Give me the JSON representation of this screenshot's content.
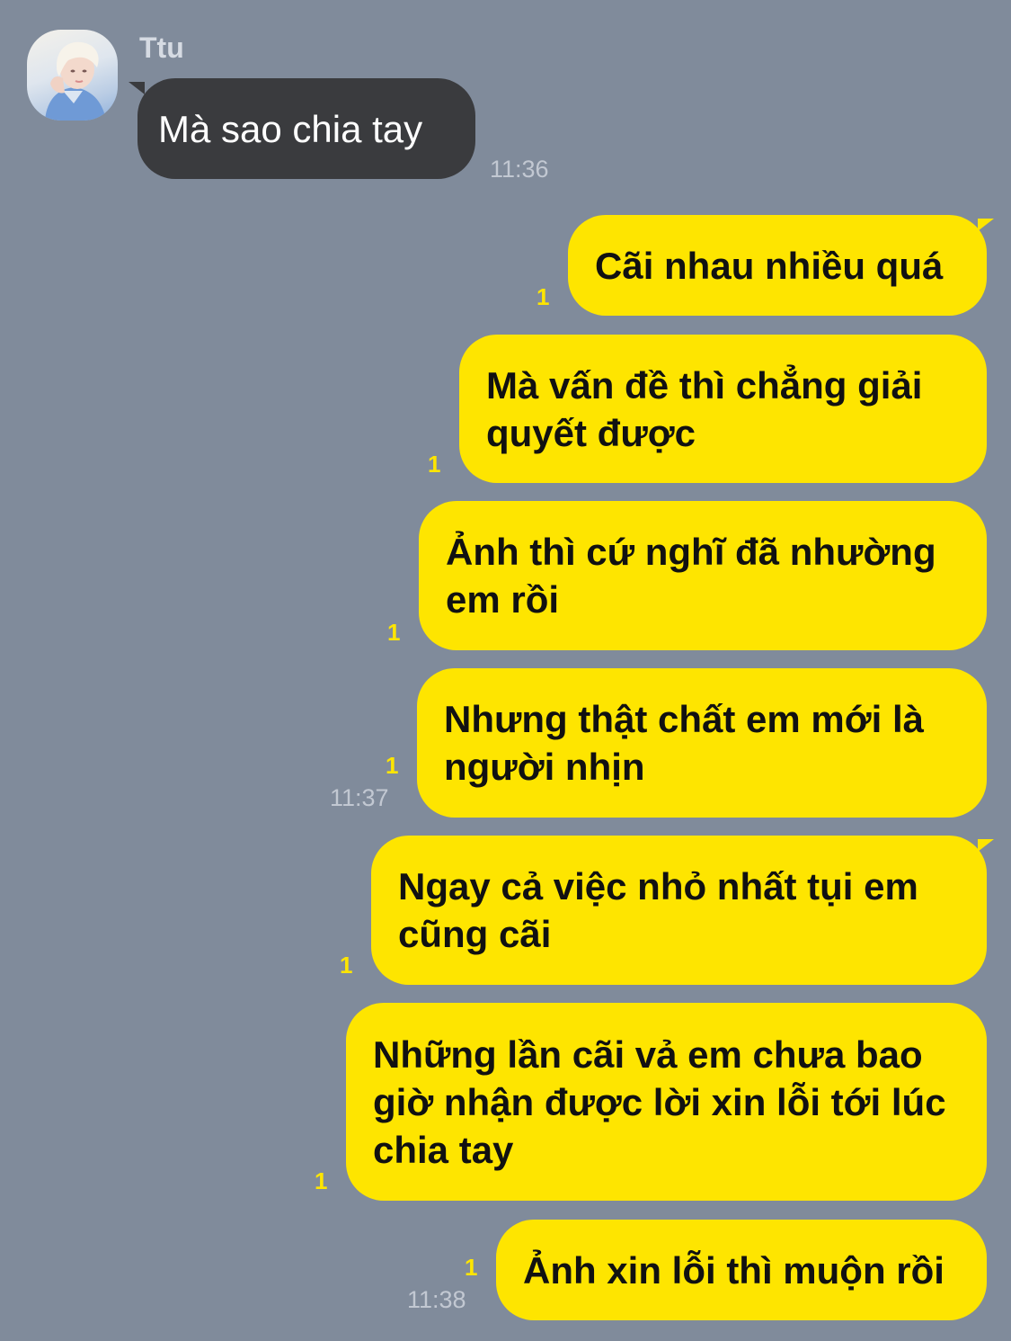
{
  "chat": {
    "contact_name": "Ttu",
    "incoming": {
      "text": "Mà sao chia tay",
      "time": "11:36"
    },
    "outgoing": [
      {
        "text": "Cãi nhau nhiều quá",
        "unread": "1",
        "time": ""
      },
      {
        "text": "Mà vấn đề thì chẳng giải\nquyết được",
        "unread": "1",
        "time": ""
      },
      {
        "text": "Ảnh thì cứ nghĩ đã nhường\nem rồi",
        "unread": "1",
        "time": ""
      },
      {
        "text": "Nhưng thật chất em mới là\nngười nhịn",
        "unread": "1",
        "time": "11:37"
      },
      {
        "text": "Ngay cả việc nhỏ nhất tụi em\ncũng cãi",
        "unread": "1",
        "time": ""
      },
      {
        "text": "Những lần cãi vả em chưa bao\ngiờ nhận được lời xin lỗi tới lúc\nchia tay",
        "unread": "1",
        "time": ""
      },
      {
        "text": "Ảnh xin lỗi thì muộn rồi",
        "unread": "1",
        "time": "11:38"
      }
    ]
  },
  "colors": {
    "background": "#808b9b",
    "incoming_bubble": "#3a3b3e",
    "outgoing_bubble": "#fee500",
    "unread_count": "#fee500",
    "timestamp": "#c2c8d2"
  },
  "icons": {
    "avatar": "profile-photo"
  }
}
